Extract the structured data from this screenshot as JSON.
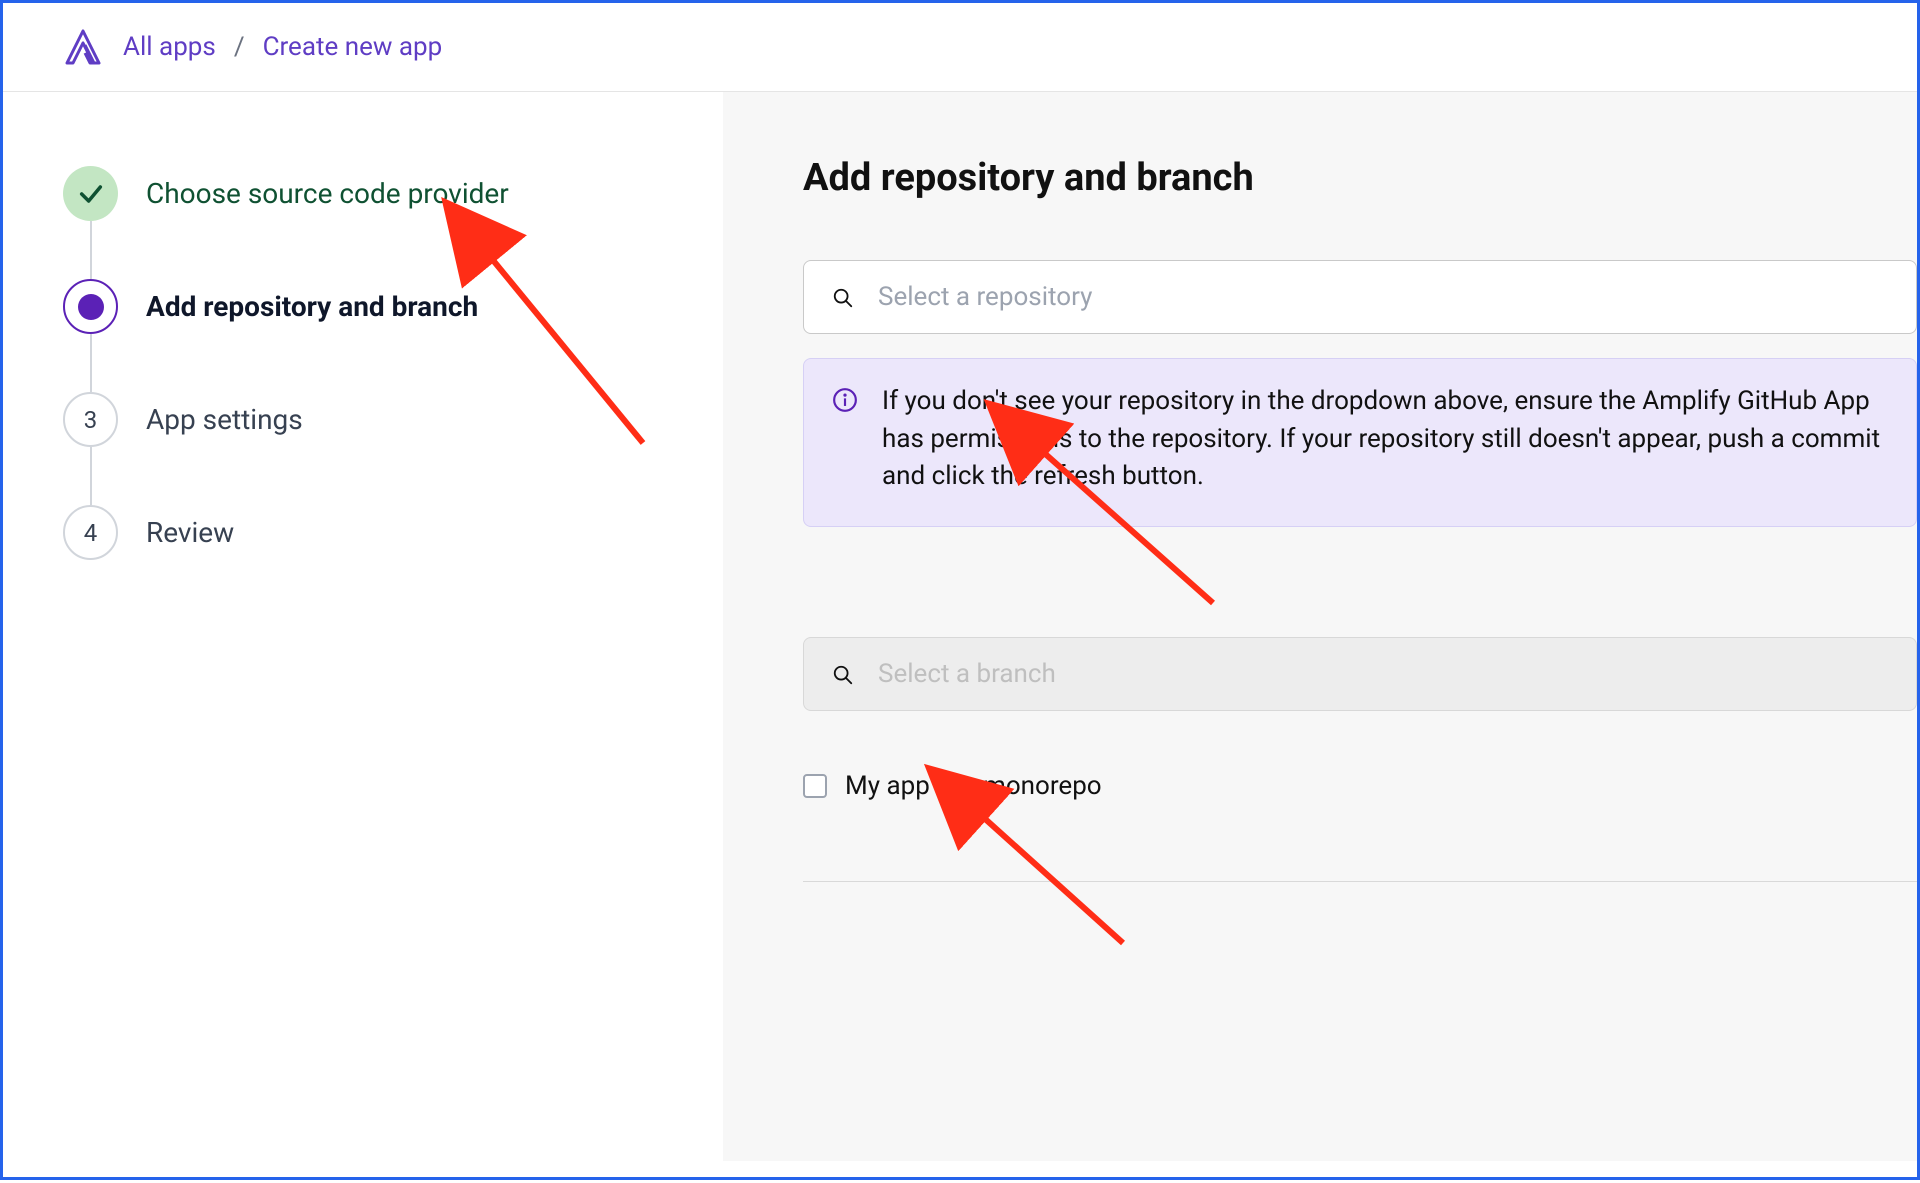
{
  "breadcrumb": {
    "all_apps": "All apps",
    "separator": "/",
    "create": "Create new app"
  },
  "steps": [
    {
      "label": "Choose source code provider",
      "state": "done"
    },
    {
      "label": "Add repository and branch",
      "state": "active"
    },
    {
      "label": "App settings",
      "state": "pending",
      "num": "3"
    },
    {
      "label": "Review",
      "state": "pending",
      "num": "4"
    }
  ],
  "main": {
    "title": "Add repository and branch",
    "repo_placeholder": "Select a repository",
    "branch_placeholder": "Select a branch",
    "info_text": "If you don't see your repository in the dropdown above, ensure the Amplify GitHub App has permissions to the repository. If your repository still doesn't appear, push a commit and click the refresh button.",
    "monorepo_label": "My app is a monorepo"
  },
  "colors": {
    "accent": "#5b21b6",
    "link": "#5f3dc4",
    "info_bg": "#ece7fb",
    "done_bg": "#c3e6c3",
    "border_blue": "#2563eb",
    "arrow": "#ff2d16"
  }
}
